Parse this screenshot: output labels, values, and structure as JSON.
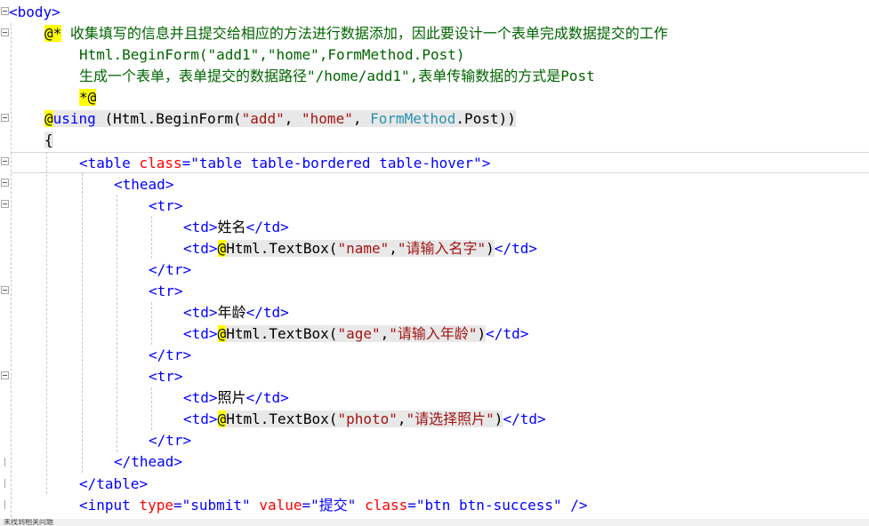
{
  "code": {
    "l1": {
      "tag": "body"
    },
    "l2": {
      "marker": "@*",
      "comment": " 收集填写的信息并且提交给相应的方法进行数据添加，因此要设计一个表单完成数据提交的工作"
    },
    "l3": {
      "comment": "Html.BeginForm(\"add1\",\"home\",FormMethod.Post)"
    },
    "l4": {
      "comment": "生成一个表单，表单提交的数据路径\"/home/add1\",表单传输数据的方式是Post"
    },
    "l5": {
      "marker": "*@"
    },
    "l6": {
      "kw": "using",
      "p1": " (Html.",
      "method": "BeginForm",
      "p2": "(",
      "s1": "\"add\"",
      "c1": ", ",
      "s2": "\"home\"",
      "c2": ", ",
      "type": "FormMethod",
      "p3": ".Post))"
    },
    "l7": {
      "brace": "{"
    },
    "l8": {
      "tag": "table",
      "attr": "class",
      "eq": "=",
      "val": "\"table table-bordered table-hover\""
    },
    "l9": {
      "tag": "thead"
    },
    "l10": {
      "tag": "tr"
    },
    "l11": {
      "tag": "td",
      "text": "姓名",
      "close": "/td"
    },
    "l12": {
      "tag": "td",
      "code": "Html.",
      "method": "TextBox",
      "s1": "\"name\"",
      "s2": "\"请输入名字\"",
      "close": "/td"
    },
    "l13": {
      "tag": "/tr"
    },
    "l14": {
      "tag": "tr"
    },
    "l15": {
      "tag": "td",
      "text": "年龄",
      "close": "/td"
    },
    "l16": {
      "tag": "td",
      "code": "Html.",
      "method": "TextBox",
      "s1": "\"age\"",
      "s2": "\"请输入年龄\"",
      "close": "/td"
    },
    "l17": {
      "tag": "/tr"
    },
    "l18": {
      "tag": "tr"
    },
    "l19": {
      "tag": "td",
      "text": "照片",
      "close": "/td"
    },
    "l20": {
      "tag": "td",
      "code": "Html.",
      "method": "TextBox",
      "s1": "\"photo\"",
      "s2": "\"请选择照片\"",
      "close": "/td"
    },
    "l21": {
      "tag": "/tr"
    },
    "l22": {
      "tag": "/thead"
    },
    "l23": {
      "tag": "/table"
    },
    "l24": {
      "tag": "input",
      "a1": "type",
      "v1": "\"submit\"",
      "a2": "value",
      "v2": "\"提交\"",
      "a3": "class",
      "v3": "\"btn btn-success\"",
      "end": " />"
    }
  },
  "status": {
    "text": "未找到相关问题"
  },
  "colors": {
    "tag": "#0000ff",
    "attr": "#ff0000",
    "string": "#a31515",
    "comment": "#006400",
    "type": "#2b91af",
    "razor_highlight": "#ffff00"
  }
}
